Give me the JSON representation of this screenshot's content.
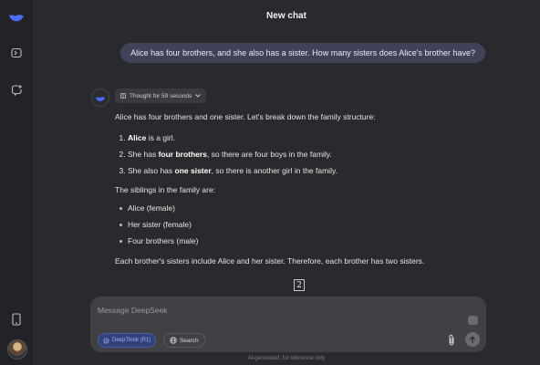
{
  "header": {
    "title": "New chat"
  },
  "sidebar": {
    "icons": [
      "deepseek-logo-icon",
      "sidebar-toggle-icon",
      "new-chat-icon",
      "phone-icon",
      "avatar"
    ]
  },
  "conversation": {
    "user_message": "Alice has four brothers, and she also has a sister. How many sisters does Alice's brother have?",
    "thought_label": "Thought for 59 seconds",
    "answer": {
      "intro": "Alice has four brothers and one sister. Let's break down the family structure:",
      "steps": [
        {
          "pre": "",
          "bold": "Alice",
          "post": " is a girl."
        },
        {
          "pre": "She has ",
          "bold": "four brothers",
          "post": ", so there are four boys in the family."
        },
        {
          "pre": "She also has ",
          "bold": "one sister",
          "post": ", so there is another girl in the family."
        }
      ],
      "siblings_heading": "The siblings in the family are:",
      "siblings": [
        "Alice (female)",
        "Her sister (female)",
        "Four brothers (male)"
      ],
      "conclusion": "Each brother's sisters include Alice and her sister. Therefore, each brother has two sisters.",
      "final_answer": "2"
    }
  },
  "composer": {
    "placeholder": "Message DeepSeek",
    "deepthink_label": "DeepThink (R1)",
    "search_label": "Search"
  },
  "footer": {
    "disclaimer": "AI-generated, for reference only"
  },
  "colors": {
    "background": "#292a2d",
    "sidebar": "#222326",
    "user_bubble": "#414158",
    "composer": "#404045",
    "deepthink_active": "#34427a",
    "brand_blue": "#4d6bfe"
  }
}
